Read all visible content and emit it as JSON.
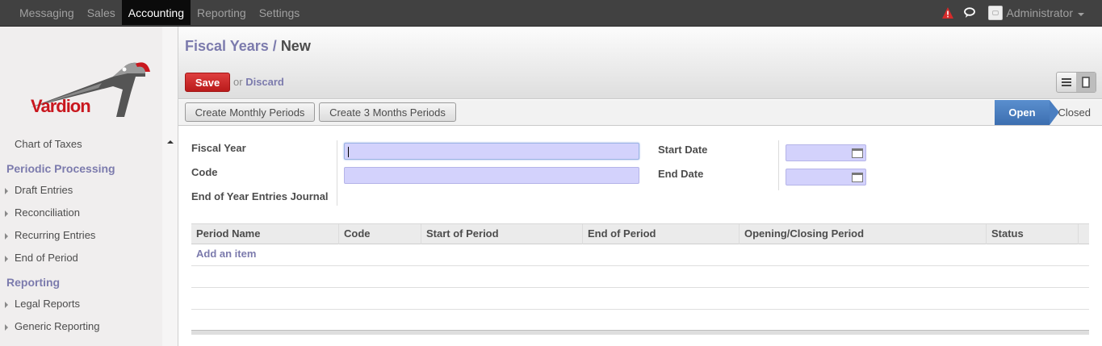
{
  "topbar": {
    "menu": [
      "Messaging",
      "Sales",
      "Accounting",
      "Reporting",
      "Settings"
    ],
    "active": "Accounting",
    "user": "Administrator",
    "icons": [
      "alert-icon",
      "chat-icon",
      "avatar"
    ],
    "alert_color": "#d62a2a"
  },
  "logo": {
    "text": "Vardion"
  },
  "sidebar": {
    "top_item": "Chart of Taxes",
    "sections": [
      {
        "title": "Periodic Processing",
        "items": [
          "Draft Entries",
          "Reconciliation",
          "Recurring Entries",
          "End of Period"
        ]
      },
      {
        "title": "Reporting",
        "items": [
          "Legal Reports",
          "Generic Reporting"
        ]
      }
    ]
  },
  "breadcrumb": {
    "parent": "Fiscal Years",
    "separator": "/",
    "current": "New"
  },
  "actions": {
    "save": "Save",
    "or": "or",
    "discard": "Discard"
  },
  "status_buttons": [
    "Create Monthly Periods",
    "Create 3 Months Periods"
  ],
  "stages": {
    "open": "Open",
    "closed": "Closed",
    "current": "Open",
    "active_color": "#4a7ec0"
  },
  "form": {
    "fiscal_year": {
      "label": "Fiscal Year",
      "value": ""
    },
    "code": {
      "label": "Code",
      "value": ""
    },
    "end_journal": {
      "label": "End of Year Entries Journal"
    },
    "start_date": {
      "label": "Start Date",
      "value": ""
    },
    "end_date": {
      "label": "End Date",
      "value": ""
    }
  },
  "grid": {
    "columns": [
      "Period Name",
      "Code",
      "Start of Period",
      "End of Period",
      "Opening/Closing Period",
      "Status"
    ],
    "add_item": "Add an item"
  },
  "colors": {
    "link": "#7c7bad",
    "save": "#c9171e",
    "required_field": "#d3d2fc"
  }
}
